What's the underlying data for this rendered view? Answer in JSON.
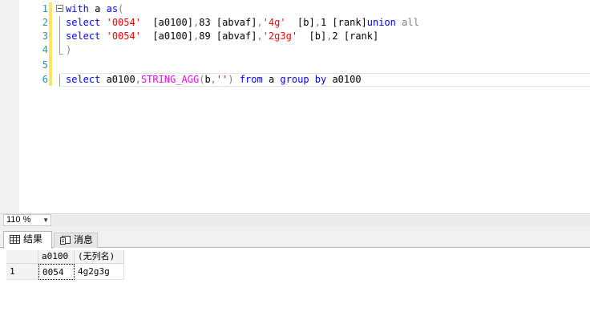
{
  "editor": {
    "line_numbers": [
      "1",
      "2",
      "3",
      "4",
      "5",
      "6"
    ],
    "lines": [
      [
        {
          "t": "with",
          "c": "kw"
        },
        {
          "t": " a ",
          "c": ""
        },
        {
          "t": "as",
          "c": "kw"
        },
        {
          "t": "(",
          "c": "op"
        }
      ],
      [
        {
          "t": "select",
          "c": "kw"
        },
        {
          "t": " ",
          "c": ""
        },
        {
          "t": "'0054'",
          "c": "str"
        },
        {
          "t": "  [a0100]",
          "c": ""
        },
        {
          "t": ",",
          "c": "op"
        },
        {
          "t": "83 [abvaf]",
          "c": ""
        },
        {
          "t": ",",
          "c": "op"
        },
        {
          "t": "'4g'",
          "c": "str"
        },
        {
          "t": "  [b]",
          "c": ""
        },
        {
          "t": ",",
          "c": "op"
        },
        {
          "t": "1 [rank]",
          "c": ""
        },
        {
          "t": "union",
          "c": "kw"
        },
        {
          "t": " ",
          "c": ""
        },
        {
          "t": "all",
          "c": "op"
        }
      ],
      [
        {
          "t": "select",
          "c": "kw"
        },
        {
          "t": " ",
          "c": ""
        },
        {
          "t": "'0054'",
          "c": "str"
        },
        {
          "t": "  [a0100]",
          "c": ""
        },
        {
          "t": ",",
          "c": "op"
        },
        {
          "t": "89 [abvaf]",
          "c": ""
        },
        {
          "t": ",",
          "c": "op"
        },
        {
          "t": "'2g3g'",
          "c": "str"
        },
        {
          "t": "  [b]",
          "c": ""
        },
        {
          "t": ",",
          "c": "op"
        },
        {
          "t": "2 [rank]",
          "c": ""
        }
      ],
      [
        {
          "t": ")",
          "c": "op"
        }
      ],
      [],
      [
        {
          "t": "select",
          "c": "kw"
        },
        {
          "t": " a0100",
          "c": ""
        },
        {
          "t": ",",
          "c": "op"
        },
        {
          "t": "STRING_AGG",
          "c": "fn"
        },
        {
          "t": "(",
          "c": "op"
        },
        {
          "t": "b",
          "c": ""
        },
        {
          "t": ",",
          "c": "op"
        },
        {
          "t": "''",
          "c": "str"
        },
        {
          "t": ")",
          "c": "op"
        },
        {
          "t": " ",
          "c": ""
        },
        {
          "t": "from",
          "c": "kw"
        },
        {
          "t": " a ",
          "c": ""
        },
        {
          "t": "group",
          "c": "kw"
        },
        {
          "t": " ",
          "c": ""
        },
        {
          "t": "by",
          "c": "kw"
        },
        {
          "t": " a0100",
          "c": ""
        }
      ]
    ]
  },
  "zoom": {
    "value": "110 %"
  },
  "results_tabs": [
    {
      "label": "结果",
      "icon": "grid-icon",
      "active": true
    },
    {
      "label": "消息",
      "icon": "messages-icon",
      "active": false
    }
  ],
  "grid": {
    "columns": [
      "a0100",
      "(无列名)"
    ],
    "rows": [
      {
        "num": "1",
        "cells": [
          "0054",
          "4g2g3g"
        ]
      }
    ]
  },
  "colors": {
    "keyword": "#0000ff",
    "string": "#ff0000",
    "function": "#ff00ff",
    "operator": "#808080",
    "line_number": "#2b91af",
    "change_bar": "#fbe46c"
  }
}
